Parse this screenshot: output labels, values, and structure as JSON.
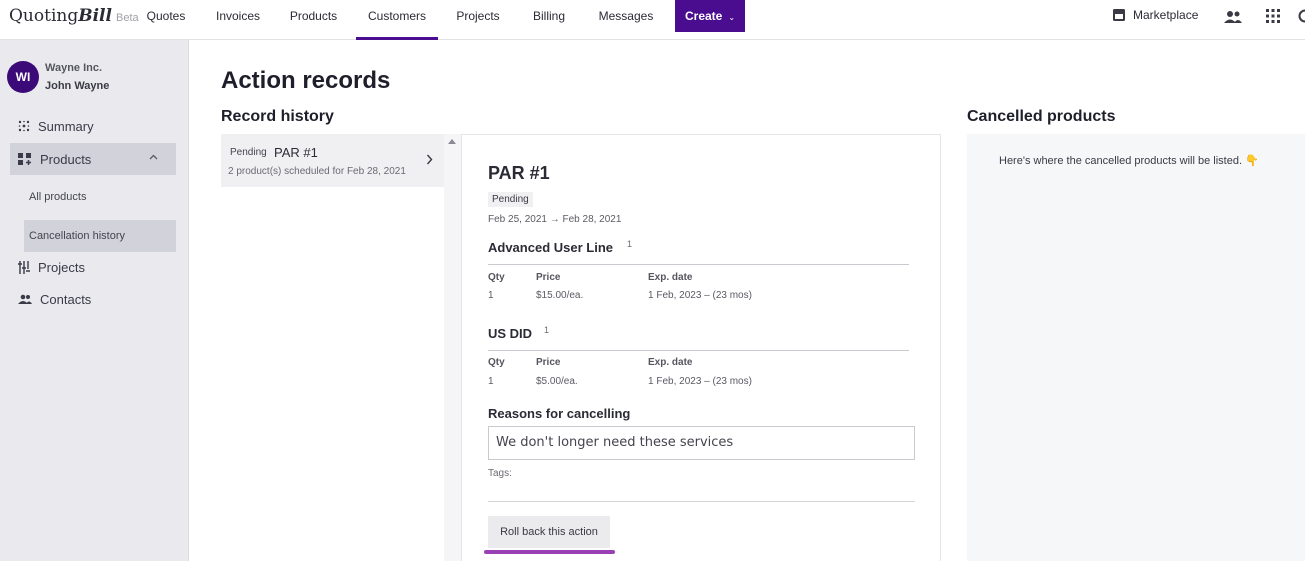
{
  "app": {
    "logo_plain": "Quoting",
    "logo_bold": "Bill",
    "beta": "Beta"
  },
  "nav": {
    "items": [
      "Quotes",
      "Invoices",
      "Products",
      "Customers",
      "Projects",
      "Billing",
      "Messages"
    ],
    "active": "Customers",
    "create_label": "Create",
    "marketplace_label": "Marketplace"
  },
  "sidebar": {
    "avatar_initials": "WI",
    "org_name": "Wayne Inc.",
    "user_name": "John Wayne",
    "items": [
      {
        "label": "Summary",
        "icon": "summary-icon"
      },
      {
        "label": "Products",
        "icon": "products-icon",
        "expanded": true
      },
      {
        "label": "Projects",
        "icon": "projects-icon"
      },
      {
        "label": "Contacts",
        "icon": "contacts-icon"
      }
    ],
    "sub_items": [
      "All products",
      "Cancellation history"
    ],
    "selected_sub": "Cancellation history"
  },
  "main": {
    "title": "Action records",
    "history_heading": "Record history",
    "cancelled_heading": "Cancelled products",
    "cancelled_message": "Here's where the cancelled products will be listed. 👇"
  },
  "records": [
    {
      "status": "Pending",
      "name": "PAR #1",
      "summary": "2 product(s) scheduled for Feb 28, 2021"
    }
  ],
  "detail": {
    "title": "PAR #1",
    "status": "Pending",
    "dates": "Feb 25, 2021 → Feb 28, 2021",
    "columns": {
      "qty": "Qty",
      "price": "Price",
      "exp": "Exp. date"
    },
    "products": [
      {
        "name": "Advanced User Line",
        "count": "1",
        "qty": "1",
        "price": "$15.00/ea.",
        "exp": "1 Feb, 2023 – (23 mos)"
      },
      {
        "name": "US DID",
        "count": "1",
        "qty": "1",
        "price": "$5.00/ea.",
        "exp": "1 Feb, 2023 – (23 mos)"
      }
    ],
    "reasons_label": "Reasons for cancelling",
    "reasons_value": "We don't longer need these services",
    "tags_label": "Tags:",
    "rollback_label": "Roll back this action"
  },
  "colors": {
    "brand": "#4a0d8f",
    "avatar": "#3c0a78",
    "highlight": "#9b3fb5"
  }
}
